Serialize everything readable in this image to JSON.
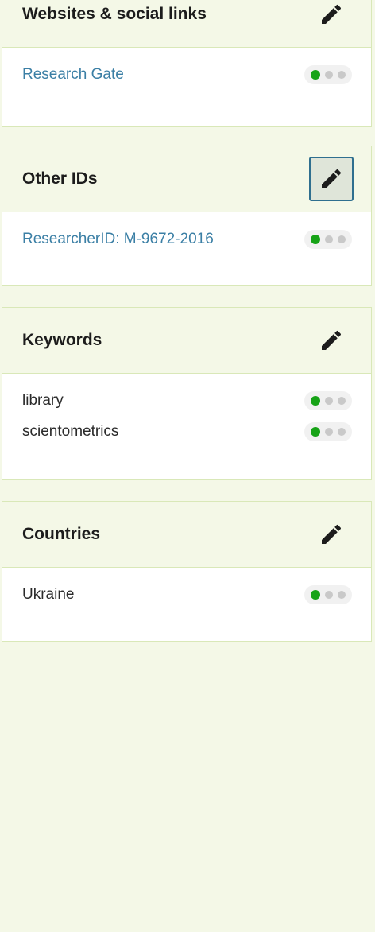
{
  "panels": [
    {
      "title": "Websites & social links",
      "items": [
        {
          "label": "Research Gate",
          "link": true
        }
      ]
    },
    {
      "title": "Other IDs",
      "items": [
        {
          "label": "ResearcherID: M-9672-2016",
          "link": true
        }
      ]
    },
    {
      "title": "Keywords",
      "items": [
        {
          "label": "library",
          "link": false
        },
        {
          "label": "scientometrics",
          "link": false
        }
      ]
    },
    {
      "title": "Countries",
      "items": [
        {
          "label": "Ukraine",
          "link": false
        }
      ]
    }
  ],
  "icons": {
    "edit": "pencil-icon",
    "visibility": "visibility-dots-icon"
  },
  "colors": {
    "page_background": "#f4f8e7",
    "panel_border": "#d9e8b8",
    "link": "#3b7fa5",
    "visibility_active": "#17a317",
    "visibility_inactive": "#c9c9c9",
    "focus_ring": "#2f6f8f"
  }
}
